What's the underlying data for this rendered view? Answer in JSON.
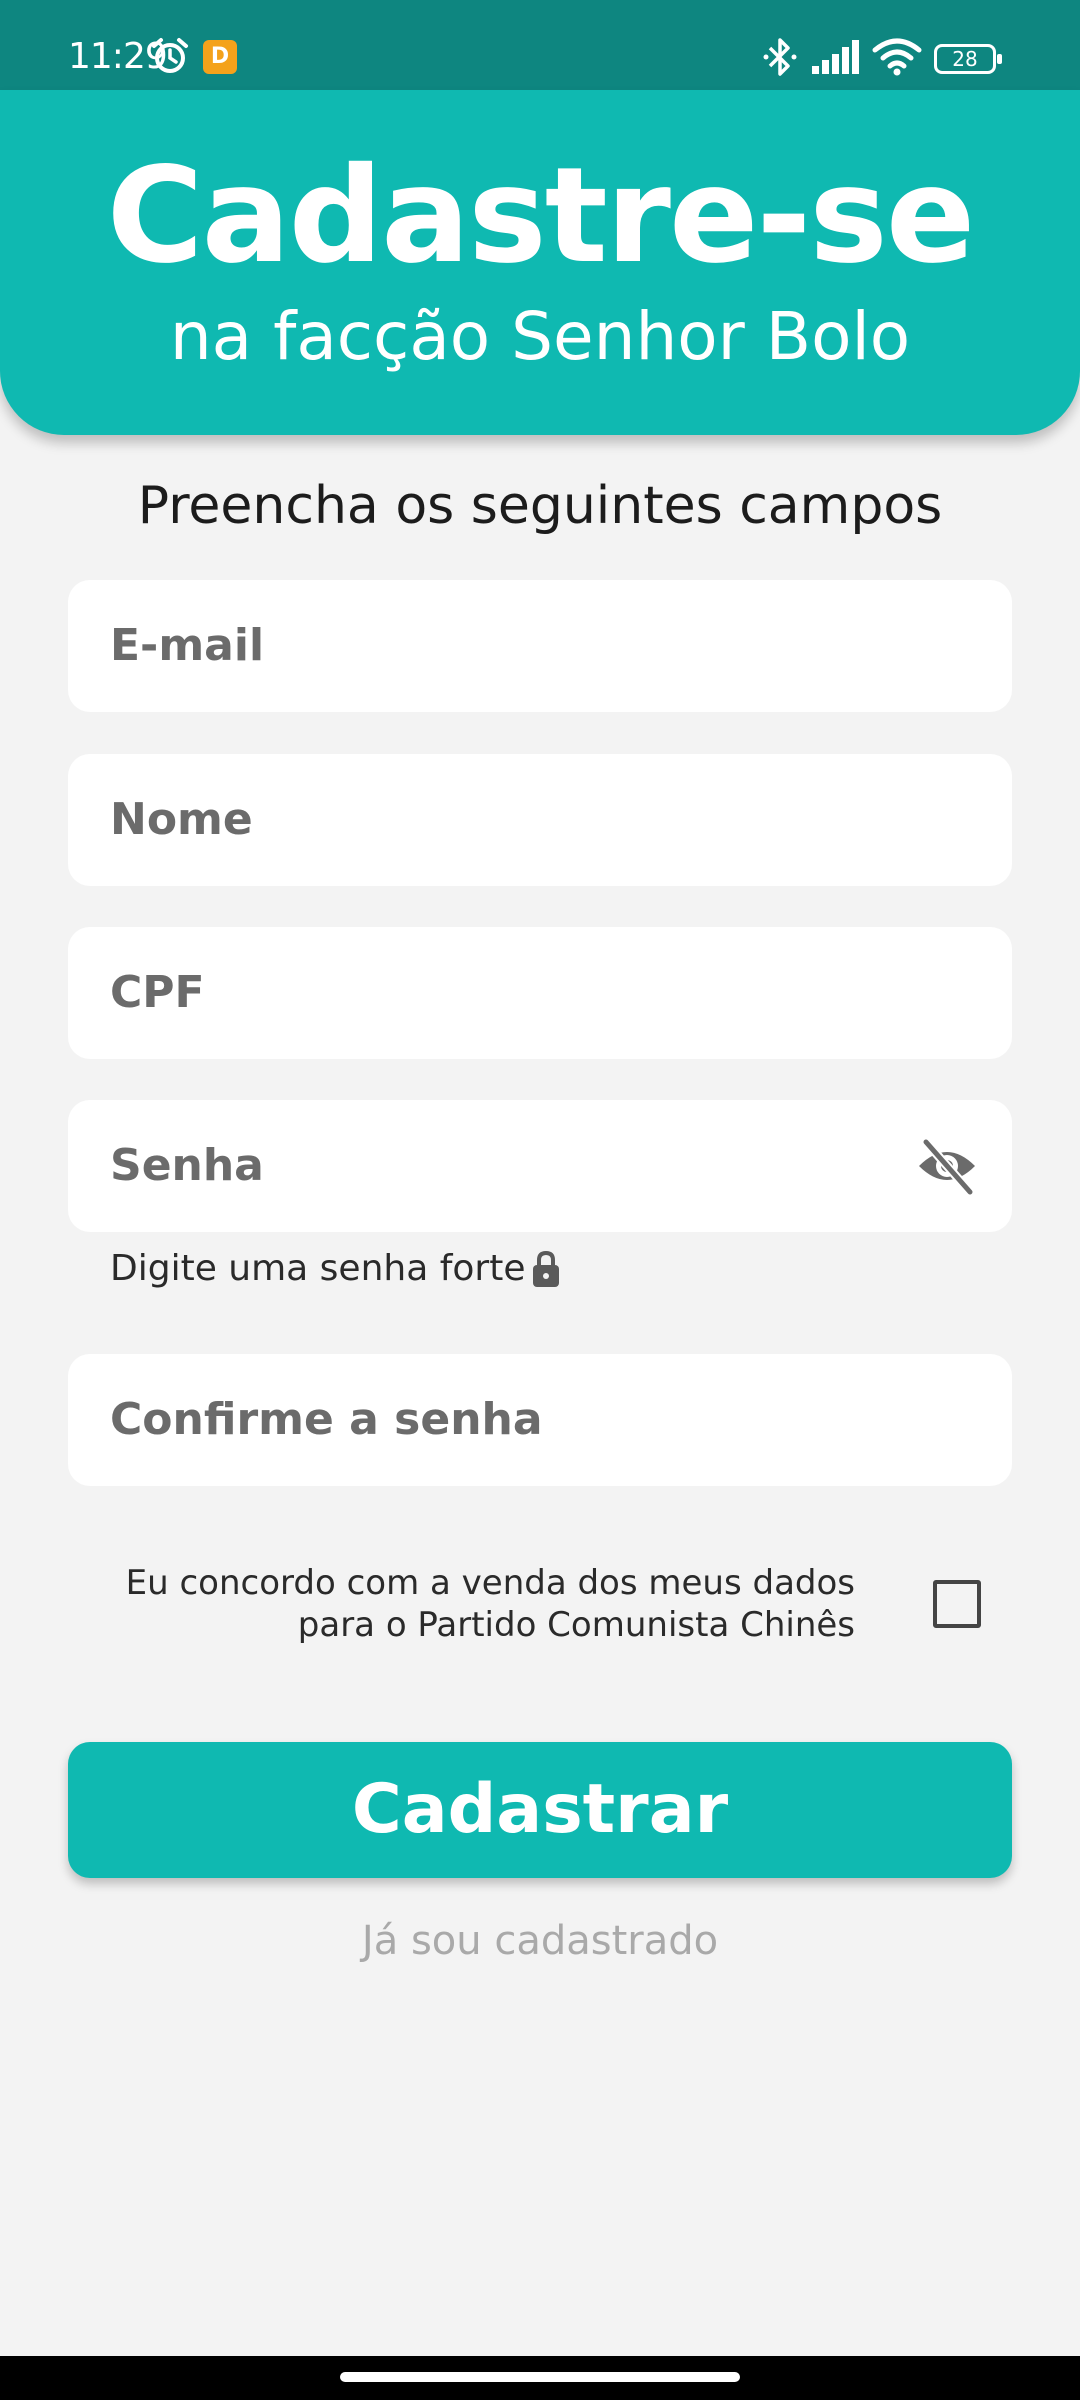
{
  "status_bar": {
    "time": "11:29",
    "app_badge": "D",
    "battery": "28"
  },
  "header": {
    "title": "Cadastre-se",
    "subtitle": "na facção Senhor Bolo"
  },
  "form": {
    "instructions": "Preencha os seguintes campos",
    "email_placeholder": "E-mail",
    "name_placeholder": "Nome",
    "cpf_placeholder": "CPF",
    "password_placeholder": "Senha",
    "password_hint": "Digite uma senha forte",
    "confirm_placeholder": "Confirme a senha",
    "consent_line1": "Eu concordo com a venda dos meus dados",
    "consent_line2": "para o Partido Comunista Chinês",
    "consent_checked": false,
    "submit_label": "Cadastrar",
    "login_link": "Já sou cadastrado"
  },
  "colors": {
    "accent": "#0fb9b1",
    "status_bar": "#0e8680",
    "background": "#f3f3f3"
  },
  "icons": [
    "alarm-icon",
    "bluetooth-icon",
    "signal-icon",
    "wifi-icon",
    "battery-icon",
    "eye-off-icon",
    "lock-icon"
  ]
}
